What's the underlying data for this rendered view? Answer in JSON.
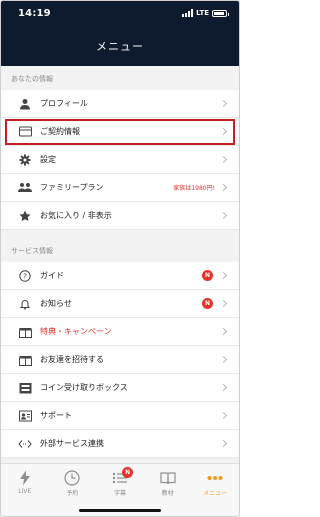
{
  "status_bar": {
    "time": "14:19",
    "network": "LTE",
    "battery_level": 0.75
  },
  "header": {
    "title": "メニュー"
  },
  "sections": [
    {
      "header": "あなたの情報",
      "items": [
        {
          "label": "プロフィール",
          "icon": "person-icon"
        },
        {
          "label": "ご契約情報",
          "icon": "card-icon",
          "highlighted": true
        },
        {
          "label": "設定",
          "icon": "gear-icon"
        },
        {
          "label": "ファミリープラン",
          "icon": "family-icon",
          "extra": "家族は1980円!"
        },
        {
          "label": "お気に入り / 非表示",
          "icon": "star-icon"
        }
      ]
    },
    {
      "header": "サービス情報",
      "items": [
        {
          "label": "ガイド",
          "icon": "question-icon",
          "badge": "N"
        },
        {
          "label": "お知らせ",
          "icon": "bell-icon",
          "badge": "N"
        },
        {
          "label": "特典・キャンペーン",
          "icon": "gift-icon",
          "red": true
        },
        {
          "label": "お友達を招待する",
          "icon": "invite-icon"
        },
        {
          "label": "コイン受け取りボックス",
          "icon": "coin-box-icon"
        },
        {
          "label": "サポート",
          "icon": "support-icon"
        },
        {
          "label": "外部サービス連携",
          "icon": "link-icon"
        }
      ]
    }
  ],
  "tabs": [
    {
      "label": "LIVE",
      "icon": "bolt-icon"
    },
    {
      "label": "予約",
      "icon": "clock-icon"
    },
    {
      "label": "字幕",
      "icon": "list-icon",
      "badge": "N"
    },
    {
      "label": "教材",
      "icon": "book-icon"
    },
    {
      "label": "メニュー",
      "icon": "menu-dots-icon",
      "active": true
    }
  ],
  "colors": {
    "navy": "#0e1a2d",
    "accent_red": "#e4342b",
    "active_orange": "#f39a1e"
  }
}
